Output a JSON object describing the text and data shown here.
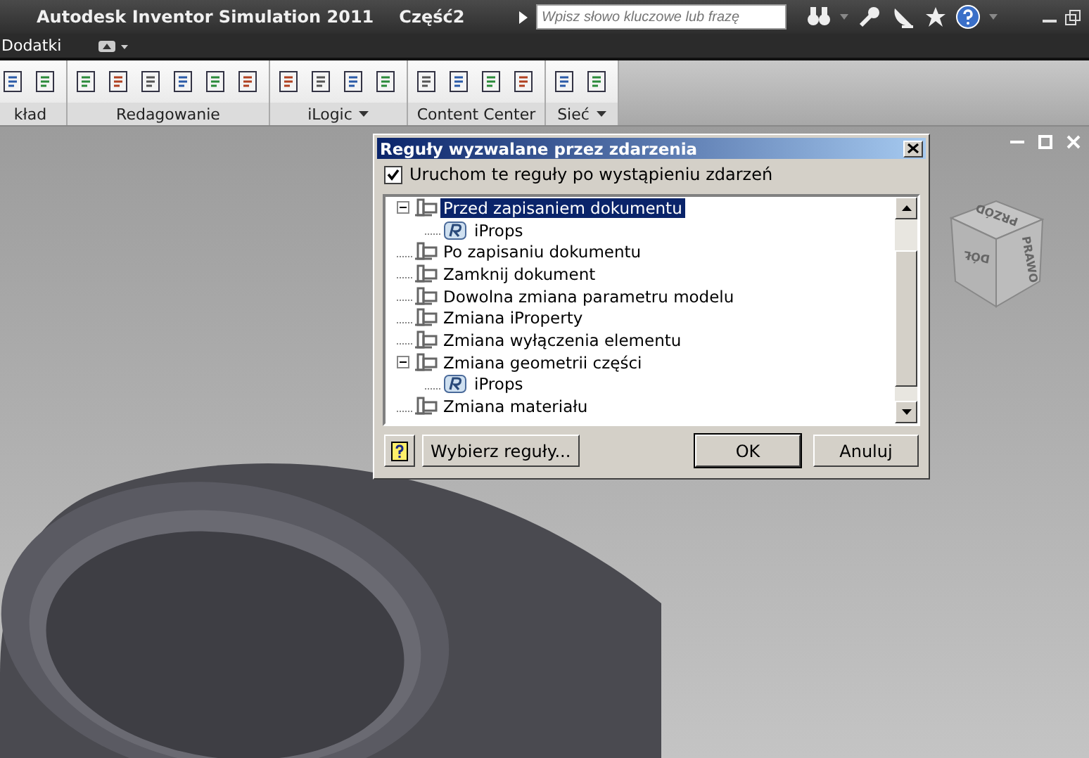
{
  "window": {
    "title": "Autodesk Inventor Simulation 2011",
    "document": "Część2",
    "search": {
      "placeholder": "Wpisz słowo kluczowe lub frazę"
    }
  },
  "tabs": [
    {
      "label": "Dodatki",
      "selected": false
    }
  ],
  "ribbon": {
    "panels": [
      {
        "label": "kład",
        "dropdown": false
      },
      {
        "label": "Redagowanie",
        "dropdown": false
      },
      {
        "label": "iLogic",
        "dropdown": true
      },
      {
        "label": "Content Center",
        "dropdown": false
      },
      {
        "label": "Sieć",
        "dropdown": true
      }
    ]
  },
  "viewcube": {
    "faces": [
      "PRZÓD",
      "PRAWO",
      "DÓŁ"
    ]
  },
  "dialog": {
    "title": "Reguły wyzwalane przez zdarzenia",
    "checkbox": {
      "label": "Uruchom te reguły po wystąpieniu zdarzeń",
      "checked": true
    },
    "tree": [
      {
        "kind": "event",
        "label": "Przed zapisaniem dokumentu",
        "selected": true,
        "expanded": true,
        "children": [
          {
            "kind": "rule",
            "label": "iProps",
            "selected": false
          }
        ]
      },
      {
        "kind": "event",
        "label": "Po zapisaniu dokumentu",
        "selected": false
      },
      {
        "kind": "event",
        "label": "Zamknij dokument",
        "selected": false
      },
      {
        "kind": "event",
        "label": "Dowolna zmiana parametru modelu",
        "selected": false
      },
      {
        "kind": "event",
        "label": "Zmiana iProperty",
        "selected": false
      },
      {
        "kind": "event",
        "label": "Zmiana wyłączenia elementu",
        "selected": false
      },
      {
        "kind": "event",
        "label": "Zmiana geometrii części",
        "selected": false,
        "expanded": true,
        "children": [
          {
            "kind": "rule",
            "label": "iProps",
            "selected": false
          }
        ]
      },
      {
        "kind": "event",
        "label": "Zmiana materiału",
        "selected": false
      }
    ],
    "buttons": [
      {
        "label": "Wybierz reguły...",
        "kind": "left"
      },
      {
        "label": "OK",
        "kind": "default"
      },
      {
        "label": "Anuluj",
        "kind": "normal"
      }
    ]
  }
}
